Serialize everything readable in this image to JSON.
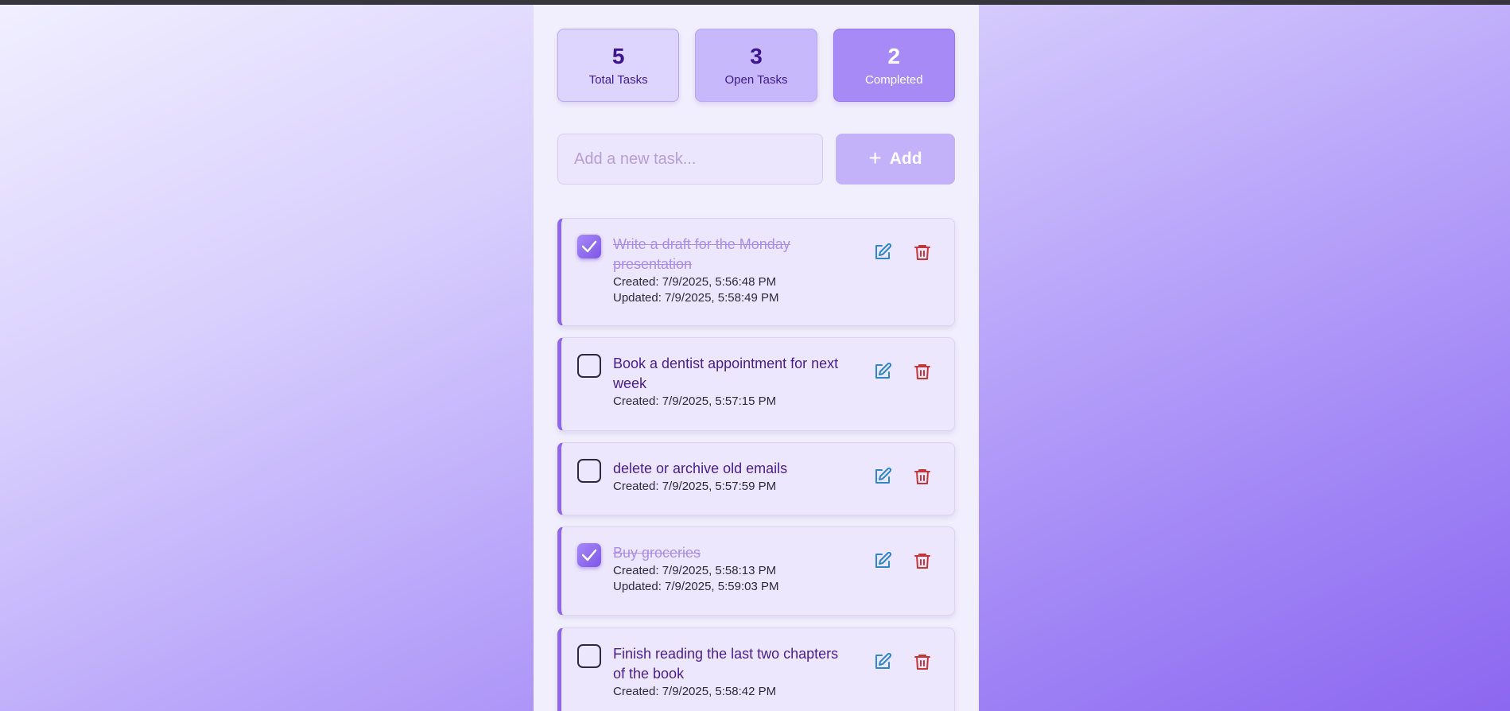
{
  "stats": {
    "total": {
      "value": "5",
      "label": "Total Tasks"
    },
    "open": {
      "value": "3",
      "label": "Open Tasks"
    },
    "completed": {
      "value": "2",
      "label": "Completed"
    }
  },
  "add_form": {
    "placeholder": "Add a new task...",
    "button_label": "Add",
    "button_icon": "plus-icon"
  },
  "icons": {
    "edit": "edit-icon",
    "delete": "trash-icon",
    "check": "check-icon"
  },
  "colors": {
    "accent": "#8f66ea",
    "completed_title": "#ab8ee8",
    "title": "#4a1d8c",
    "edit_icon": "#2f86c9",
    "delete_icon": "#c2363a"
  },
  "tasks": [
    {
      "title": "Write a draft for the Monday presentation",
      "completed": true,
      "created": "Created: 7/9/2025, 5:56:48 PM",
      "updated": "Updated: 7/9/2025, 5:58:49 PM"
    },
    {
      "title": "Book a dentist appointment for next week",
      "completed": false,
      "created": "Created: 7/9/2025, 5:57:15 PM"
    },
    {
      "title": "delete or archive old emails",
      "completed": false,
      "created": "Created: 7/9/2025, 5:57:59 PM"
    },
    {
      "title": "Buy groceries",
      "completed": true,
      "created": "Created: 7/9/2025, 5:58:13 PM",
      "updated": "Updated: 7/9/2025, 5:59:03 PM"
    },
    {
      "title": "Finish reading the last two chapters of the book",
      "completed": false,
      "created": "Created: 7/9/2025, 5:58:42 PM"
    }
  ]
}
